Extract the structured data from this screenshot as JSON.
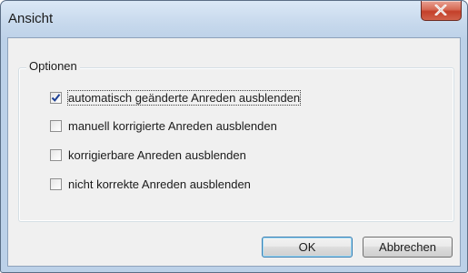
{
  "window": {
    "title": "Ansicht"
  },
  "group": {
    "legend": "Optionen"
  },
  "options": [
    {
      "label": "automatisch geänderte Anreden ausblenden",
      "checked": true,
      "focused": true
    },
    {
      "label": "manuell korrigierte Anreden ausblenden",
      "checked": false,
      "focused": false
    },
    {
      "label": "korrigierbare Anreden ausblenden",
      "checked": false,
      "focused": false
    },
    {
      "label": "nicht korrekte Anreden ausblenden",
      "checked": false,
      "focused": false
    }
  ],
  "buttons": {
    "ok_label": "OK",
    "cancel_label": "Abbrechen"
  },
  "icons": {
    "close": "close-icon",
    "check": "checkmark-icon"
  },
  "colors": {
    "close_button": "#c4402a",
    "check": "#1c3f94",
    "default_button_border": "#3c7fb1"
  }
}
